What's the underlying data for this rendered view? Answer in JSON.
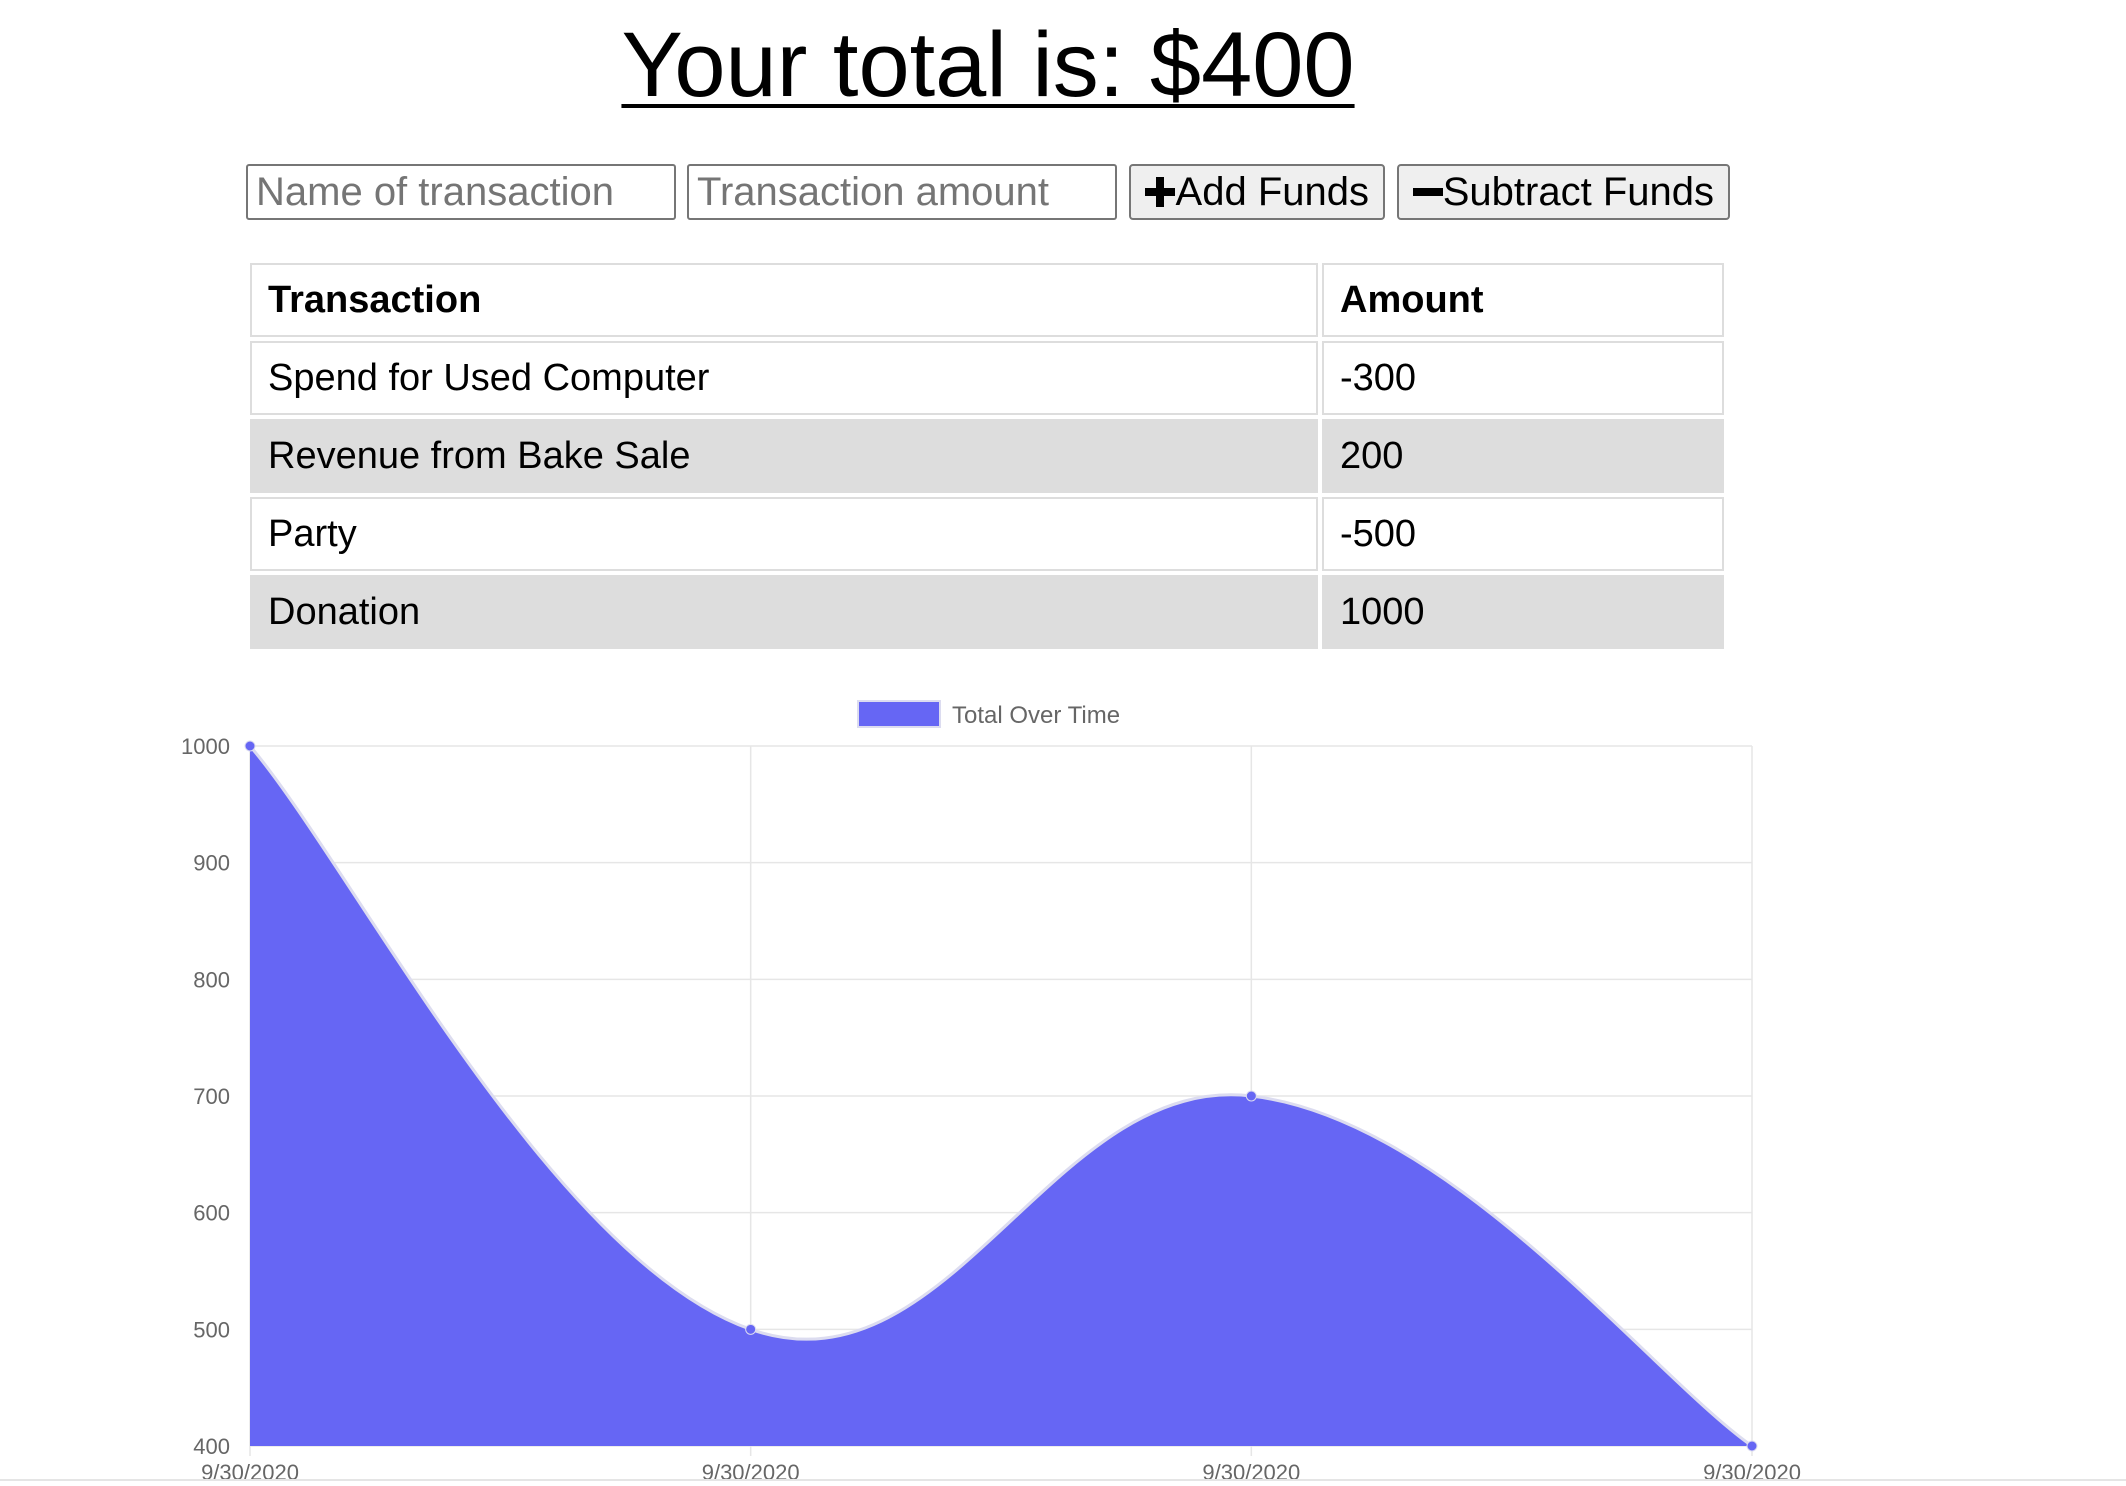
{
  "header": {
    "title": "Your total is: $400"
  },
  "form": {
    "name_placeholder": "Name of transaction",
    "amount_placeholder": "Transaction amount",
    "add_label": "Add Funds",
    "add_icon": "plus-icon",
    "subtract_label": "Subtract Funds",
    "subtract_icon": "minus-icon"
  },
  "table": {
    "headers": [
      "Transaction",
      "Amount"
    ],
    "rows": [
      {
        "name": "Spend for Used Computer",
        "amount": "-300"
      },
      {
        "name": "Revenue from Bake Sale",
        "amount": "200"
      },
      {
        "name": "Party",
        "amount": "-500"
      },
      {
        "name": "Donation",
        "amount": "1000"
      }
    ],
    "shaded_row_color": "#dddddd"
  },
  "chart_data": {
    "type": "area",
    "title": "",
    "legend": {
      "position": "top",
      "labels": [
        "Total Over Time"
      ]
    },
    "x": [
      "9/30/2020",
      "9/30/2020",
      "9/30/2020",
      "9/30/2020"
    ],
    "series": [
      {
        "name": "Total Over Time",
        "values": [
          1000,
          500,
          700,
          400
        ],
        "color": "#6666f4"
      }
    ],
    "ylim": [
      400,
      1000
    ],
    "yticks": [
      1000,
      900,
      800,
      700,
      600,
      500,
      400
    ],
    "grid": true,
    "smooth": true
  }
}
